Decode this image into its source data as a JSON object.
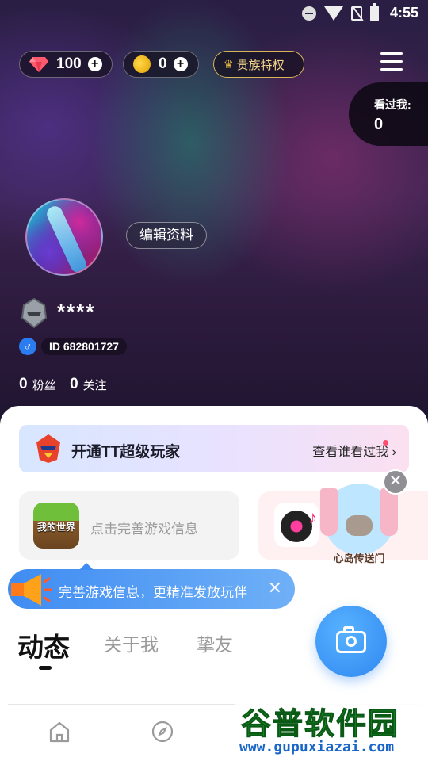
{
  "status_bar": {
    "time": "4:55"
  },
  "wallet": {
    "diamonds": "100",
    "beans": "0",
    "noble_label": "贵族特权",
    "plus": "+"
  },
  "visitors": {
    "label": "看过我:",
    "count": "0"
  },
  "profile": {
    "edit_label": "编辑资料",
    "nickname": "****",
    "id_text": "ID 682801727",
    "gender_symbol": "♂",
    "fans_count": "0",
    "fans_label": "粉丝",
    "following_count": "0",
    "following_label": "关注"
  },
  "vip": {
    "title": "开通TT超级玩家",
    "link": "查看谁看过我",
    "chevron": "›"
  },
  "game_card": {
    "icon_text": "我的世界",
    "prompt": "点击完善游戏信息"
  },
  "island": {
    "label": "心岛传送门"
  },
  "close_symbol": "✕",
  "tip": {
    "text": "完善游戏信息，更精准发放玩伴",
    "close": "✕"
  },
  "tabs": [
    {
      "label": "动态"
    },
    {
      "label": "关于我"
    },
    {
      "label": "挚友"
    }
  ],
  "watermark": {
    "top": "谷普软件园",
    "bottom": "www.gupuxiazai.com"
  },
  "colors": {
    "accent": "#2f88f0",
    "vip_dot": "#ff4a6a",
    "sheet": "#ffffff"
  },
  "icons": [
    "diamond-icon",
    "bean-icon",
    "crown-icon",
    "menu-icon",
    "camera-icon",
    "home-icon",
    "discover-icon",
    "megaphone-icon"
  ]
}
